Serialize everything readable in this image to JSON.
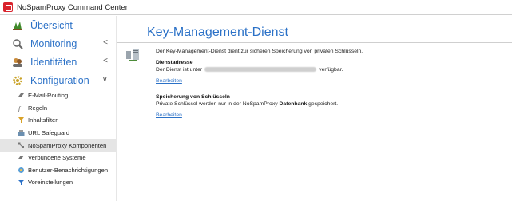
{
  "window": {
    "title": "NoSpamProxy Command Center"
  },
  "sidebar": {
    "main_items": [
      {
        "label": "Übersicht",
        "icon": "overview-icon"
      },
      {
        "label": "Monitoring",
        "icon": "monitoring-icon",
        "chevron": "<"
      },
      {
        "label": "Identitäten",
        "icon": "identities-icon",
        "chevron": "<"
      },
      {
        "label": "Konfiguration",
        "icon": "configuration-icon",
        "chevron": "∨"
      }
    ],
    "sub_items": [
      {
        "label": "E-Mail-Routing",
        "icon": "email-routing-icon"
      },
      {
        "label": "Regeln",
        "icon": "rules-icon"
      },
      {
        "label": "Inhaltsfilter",
        "icon": "content-filter-icon"
      },
      {
        "label": "URL Safeguard",
        "icon": "url-safeguard-icon"
      },
      {
        "label": "NoSpamProxy Komponenten",
        "icon": "components-icon",
        "selected": true
      },
      {
        "label": "Verbundene Systeme",
        "icon": "connected-systems-icon"
      },
      {
        "label": "Benutzer-Benachrichtigungen",
        "icon": "notifications-icon"
      },
      {
        "label": "Voreinstellungen",
        "icon": "presets-icon"
      }
    ]
  },
  "main": {
    "title": "Key-Management-Dienst",
    "intro": "Der Key-Management-Dienst dient zur sicheren Speicherung von privaten Schlüsseln.",
    "address_heading": "Dienstadresse",
    "address_text_before": "Der Dienst ist unter",
    "address_text_after": "verfügbar.",
    "edit_label_1": "Bearbeiten",
    "storage_heading": "Speicherung von Schlüsseln",
    "storage_text_before": "Private Schlüssel werden nur in der NoSpamProxy",
    "storage_text_bold": "Datenbank",
    "storage_text_after": "gespeichert.",
    "edit_label_2": "Bearbeiten"
  },
  "colors": {
    "accent": "#2b71c7",
    "brand": "#d9232d",
    "selected_bg": "#e5e5e5"
  }
}
